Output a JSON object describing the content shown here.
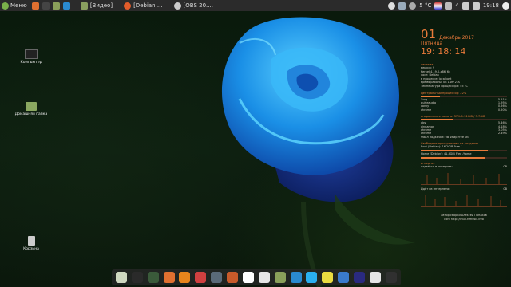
{
  "panel": {
    "menu_label": "Меню",
    "tasks": [
      {
        "label": "[Видео]",
        "color": "#8aa060"
      },
      {
        "label": "[Debian ...",
        "color": "#e25c2a"
      },
      {
        "label": "[OBS 20....",
        "color": "#cccccc"
      }
    ],
    "tray": {
      "temp": "5 °C",
      "num": "4",
      "time": "19:18"
    }
  },
  "desktop_icons": [
    {
      "label": "Компьютер"
    },
    {
      "label": "Домашняя папка"
    },
    {
      "label": "Корзина"
    }
  ],
  "conky": {
    "day": "01",
    "month_year": "Декабрь 2017",
    "weekday": "Пятница",
    "time": "19: 18: 14",
    "system_header": "система",
    "system_lines": [
      "версия: 9",
      "Kernel 4.19.0-x86_64",
      "хост: Debian",
      "в процессе: localhost",
      "время работы: 0h 14m 23s",
      "Температура процессора: 55 °C"
    ],
    "cpu_header": "Центральный процессор: 22%",
    "cpu_percent": 22,
    "cpu_rows": [
      {
        "name": "Xorg",
        "value": "5.51%"
      },
      {
        "name": "pulseaudio",
        "value": "1.95%"
      },
      {
        "name": "conky",
        "value": "0.56%"
      },
      {
        "name": "chrome",
        "value": "0.50%"
      }
    ],
    "ram_header": "оперативная память: 37% 1.31GiB / 3.7GiB",
    "ram_percent": 37,
    "ram_rows": [
      {
        "name": "obs",
        "value": "5.46%"
      },
      {
        "name": "cinnamon",
        "value": "4.18%"
      },
      {
        "name": "chrome",
        "value": "3.05%"
      },
      {
        "name": "chrome",
        "value": "2.49%"
      }
    ],
    "swap_header": "Файл подкачки: 0B    swap Free 0B",
    "disks_header": "Свободное пространство на разделах",
    "disks": [
      {
        "label": "Root (Debian): 16.2GiB Free /",
        "percent": 78
      },
      {
        "label": "Home (Debian): 41.4GiB Free /home",
        "percent": 74
      }
    ],
    "net_header": "интернет",
    "up_label": "отдаётся в интернет:",
    "up_value": "0B",
    "down_label": "Идёт из интернета:",
    "down_value": "0B",
    "footer": [
      "автор сборки Алексей Попаков",
      "conf http://linux.ttmusic.info"
    ]
  },
  "dock_items": [
    {
      "name": "show-desktop",
      "color": "#cfd8c0"
    },
    {
      "name": "terminal",
      "color": "#2a2a2a"
    },
    {
      "name": "system-monitor",
      "color": "#3a5a3a"
    },
    {
      "name": "firefox",
      "color": "#e07030"
    },
    {
      "name": "vlc",
      "color": "#e8851c"
    },
    {
      "name": "hexchat",
      "color": "#d04040"
    },
    {
      "name": "obs",
      "color": "#5a6a78"
    },
    {
      "name": "image-viewer",
      "color": "#c85a2a"
    },
    {
      "name": "text-editor",
      "color": "#ffffff"
    },
    {
      "name": "calculator",
      "color": "#e6e6e6"
    },
    {
      "name": "file-manager",
      "color": "#8aa05a"
    },
    {
      "name": "mail",
      "color": "#2a8ad0"
    },
    {
      "name": "skype",
      "color": "#2ab0f0"
    },
    {
      "name": "chrome",
      "color": "#eadc40"
    },
    {
      "name": "thunderbird",
      "color": "#3a7acc"
    },
    {
      "name": "media-player",
      "color": "#2a2a80"
    },
    {
      "name": "steam",
      "color": "#e6e6e6"
    },
    {
      "name": "obs-studio",
      "color": "#303030"
    }
  ]
}
